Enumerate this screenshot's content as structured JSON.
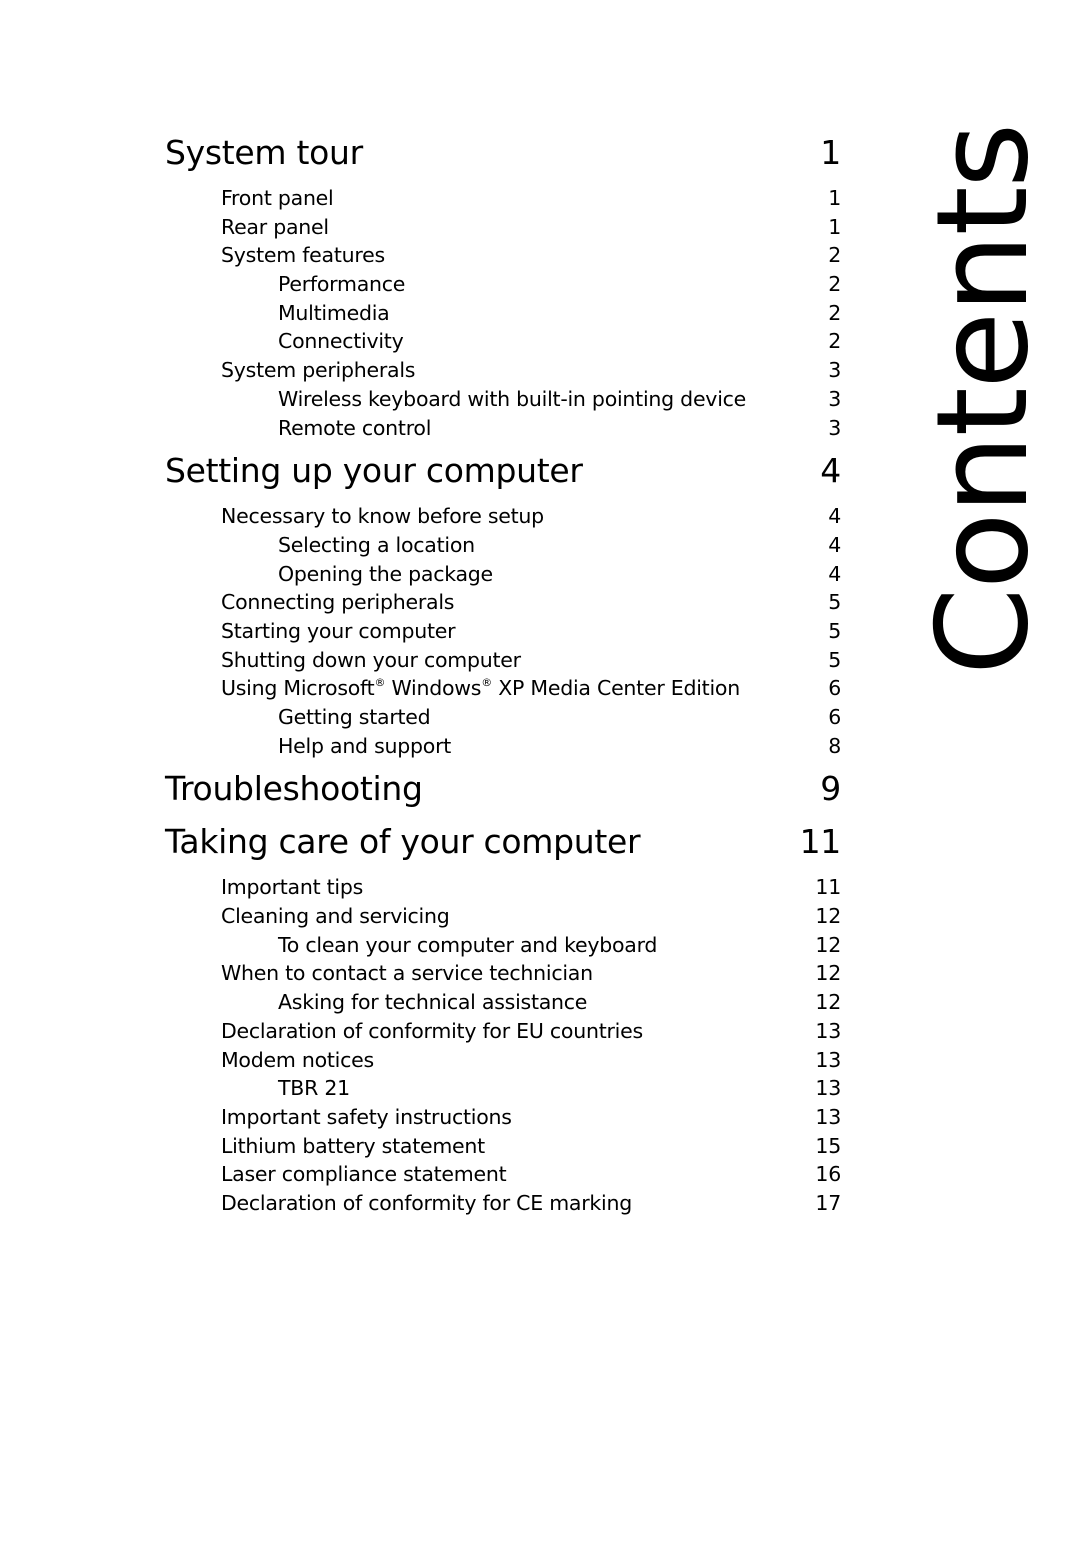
{
  "page": {
    "side_title": "Contents"
  },
  "toc": [
    {
      "title": "System tour",
      "page": "1",
      "entries": [
        {
          "level": 1,
          "title": "Front panel",
          "page": "1"
        },
        {
          "level": 1,
          "title": "Rear panel",
          "page": "1"
        },
        {
          "level": 1,
          "title": "System features",
          "page": "2"
        },
        {
          "level": 2,
          "title": "Performance",
          "page": "2"
        },
        {
          "level": 2,
          "title": "Multimedia",
          "page": "2"
        },
        {
          "level": 2,
          "title": "Connectivity",
          "page": "2"
        },
        {
          "level": 1,
          "title": "System peripherals",
          "page": "3"
        },
        {
          "level": 2,
          "title": "Wireless keyboard with built-in pointing device",
          "page": "3"
        },
        {
          "level": 2,
          "title": "Remote control",
          "page": "3"
        }
      ]
    },
    {
      "title": "Setting up your computer",
      "page": "4",
      "entries": [
        {
          "level": 1,
          "title": "Necessary to know before setup",
          "page": "4"
        },
        {
          "level": 2,
          "title": "Selecting a location",
          "page": "4"
        },
        {
          "level": 2,
          "title": "Opening the package",
          "page": "4"
        },
        {
          "level": 1,
          "title": "Connecting peripherals",
          "page": "5"
        },
        {
          "level": 1,
          "title": "Starting your computer",
          "page": "5"
        },
        {
          "level": 1,
          "title": "Shutting down your computer",
          "page": "5"
        },
        {
          "level": 1,
          "title": "Using Microsoft® Windows® XP Media Center Edition",
          "page": "6"
        },
        {
          "level": 2,
          "title": "Getting started",
          "page": "6"
        },
        {
          "level": 2,
          "title": "Help and support",
          "page": "8"
        }
      ]
    },
    {
      "title": "Troubleshooting",
      "page": "9",
      "entries": []
    },
    {
      "title": "Taking care of your computer",
      "page": "11",
      "entries": [
        {
          "level": 1,
          "title": "Important tips",
          "page": "11"
        },
        {
          "level": 1,
          "title": "Cleaning and servicing",
          "page": "12"
        },
        {
          "level": 2,
          "title": "To clean your computer and keyboard",
          "page": "12"
        },
        {
          "level": 1,
          "title": "When to contact a service technician",
          "page": "12"
        },
        {
          "level": 2,
          "title": "Asking for technical assistance",
          "page": "12"
        },
        {
          "level": 1,
          "title": "Declaration of conformity for EU countries",
          "page": "13"
        },
        {
          "level": 1,
          "title": "Modem notices",
          "page": "13"
        },
        {
          "level": 2,
          "title": "TBR 21",
          "page": "13"
        },
        {
          "level": 1,
          "title": "Important safety instructions",
          "page": "13"
        },
        {
          "level": 1,
          "title": "Lithium battery statement",
          "page": "15"
        },
        {
          "level": 1,
          "title": "Laser compliance statement",
          "page": "16"
        },
        {
          "level": 1,
          "title": "Declaration of conformity for CE marking",
          "page": "17"
        }
      ]
    }
  ]
}
